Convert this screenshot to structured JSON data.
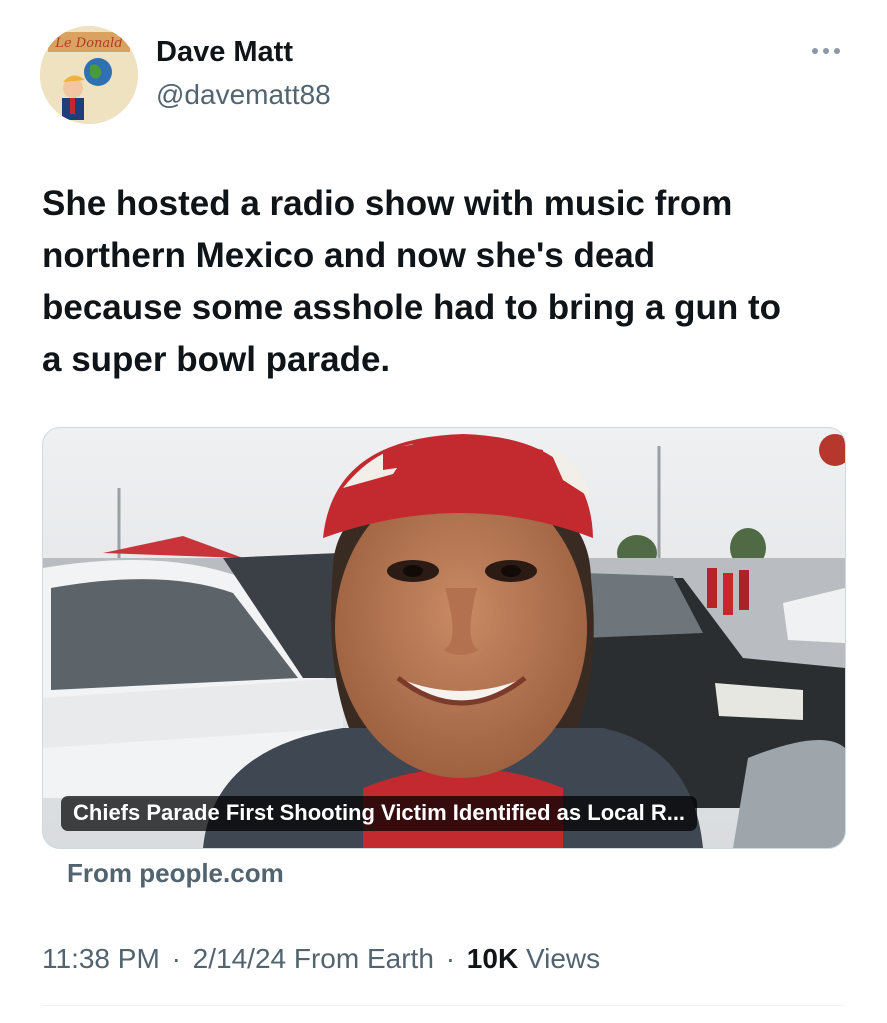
{
  "author": {
    "display_name": "Dave Matt",
    "handle": "@davematt88",
    "avatar_icon": "book-cover-avatar",
    "avatar_book_title": "Le Donald"
  },
  "more_icon": "more-horizontal-icon",
  "tweet": {
    "text": "She hosted a radio show with music from\nnorthern Mexico and now she's dead\nbecause some asshole had to bring a gun to\na super bowl parade."
  },
  "card": {
    "title": "Chiefs Parade First Shooting Victim Identified as Local R...",
    "source": "From people.com"
  },
  "meta": {
    "time": "11:38 PM",
    "date": "2/14/24",
    "location": "From Earth",
    "views_count": "10K",
    "views_label": "Views",
    "separator": "·"
  },
  "colors": {
    "text_primary": "#0f1419",
    "text_secondary": "#536471",
    "border": "#cfd9de"
  }
}
